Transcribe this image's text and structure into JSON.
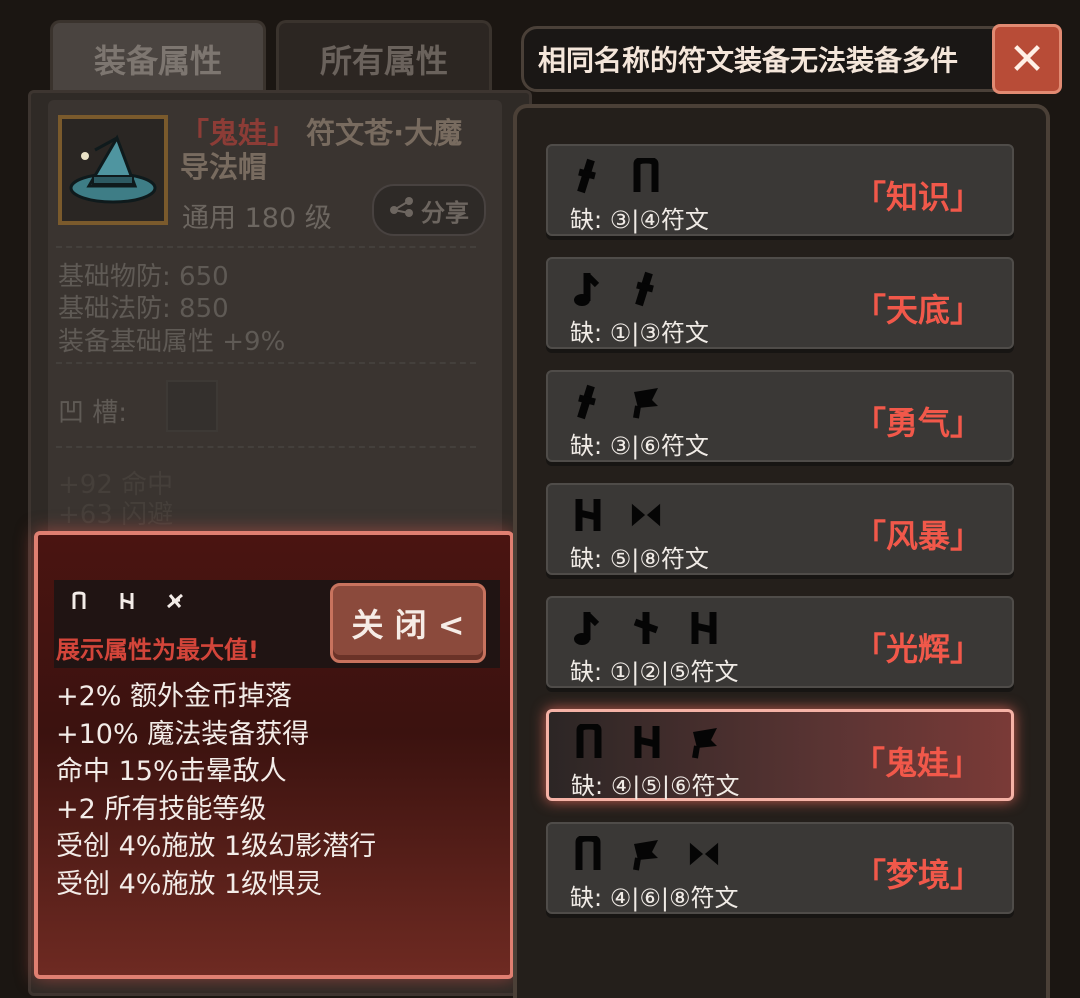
{
  "tabs": [
    {
      "label": "装备属性",
      "active": true
    },
    {
      "label": "所有属性",
      "active": false
    }
  ],
  "item": {
    "name_quote": "「鬼娃」",
    "name_rest": "符文苍·大魔导法帽",
    "level_line": "通用 180 级",
    "share_label": "分享",
    "stats": [
      "基础物防: 650",
      "基础法防: 850",
      "装备基础属性 +9%"
    ],
    "socket_label": "凹   槽:",
    "faint_stats": [
      "+92 命中",
      "+63 闪避"
    ]
  },
  "tooltip": {
    "note": "展示属性为最大值!",
    "close_label": "关 闭 <",
    "lines": [
      "+2% 额外金币掉落",
      "+10% 魔法装备获得",
      "命中 15%击晕敌人",
      "+2 所有技能等级",
      "受创 4%施放 1级幻影潜行",
      "受创 4%施放 1级惧灵"
    ],
    "runes": [
      "rune-n-icon",
      "rune-h-icon",
      "rune-star-icon"
    ]
  },
  "notice": {
    "text": "相同名称的符文装备无法装备多件",
    "close_icon": "close-icon"
  },
  "rune_words": [
    {
      "name": "「知识」",
      "missing_prefix": "缺:",
      "missing": [
        "③",
        "④"
      ],
      "suffix": "符文",
      "glyphs": [
        "rune-slash-icon",
        "rune-n-icon"
      ],
      "selected": false
    },
    {
      "name": "「天底」",
      "missing_prefix": "缺:",
      "missing": [
        "①",
        "③"
      ],
      "suffix": "符文",
      "glyphs": [
        "rune-note-icon",
        "rune-slash-icon"
      ],
      "selected": false
    },
    {
      "name": "「勇气」",
      "missing_prefix": "缺:",
      "missing": [
        "③",
        "⑥"
      ],
      "suffix": "符文",
      "glyphs": [
        "rune-slash-icon",
        "rune-flag-icon"
      ],
      "selected": false
    },
    {
      "name": "「风暴」",
      "missing_prefix": "缺:",
      "missing": [
        "⑤",
        "⑧"
      ],
      "suffix": "符文",
      "glyphs": [
        "rune-h-icon",
        "rune-bowtie-icon"
      ],
      "selected": false
    },
    {
      "name": "「光辉」",
      "missing_prefix": "缺:",
      "missing": [
        "①",
        "②",
        "⑤"
      ],
      "suffix": "符文",
      "glyphs": [
        "rune-note-icon",
        "rune-cross-icon",
        "rune-h-icon"
      ],
      "selected": false
    },
    {
      "name": "「鬼娃」",
      "missing_prefix": "缺:",
      "missing": [
        "④",
        "⑤",
        "⑥"
      ],
      "suffix": "符文",
      "glyphs": [
        "rune-n-icon",
        "rune-h-icon",
        "rune-flag-icon"
      ],
      "selected": true
    },
    {
      "name": "「梦境」",
      "missing_prefix": "缺:",
      "missing": [
        "④",
        "⑥",
        "⑧"
      ],
      "suffix": "符文",
      "glyphs": [
        "rune-n-icon",
        "rune-flag-icon",
        "rune-bowtie-icon"
      ],
      "selected": false
    }
  ],
  "colors": {
    "accent_red": "#f1584a",
    "tooltip_border": "#e07f71",
    "close_button": "#b84c37"
  }
}
